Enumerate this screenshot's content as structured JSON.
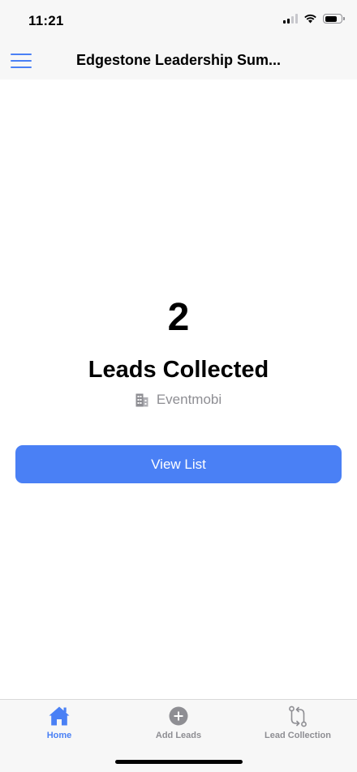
{
  "status_bar": {
    "time": "11:21"
  },
  "header": {
    "title": "Edgestone Leadership Sum...",
    "menu_icon": "hamburger-menu-icon"
  },
  "summary": {
    "lead_count": "2",
    "label": "Leads Collected",
    "organization": "Eventmobi",
    "organization_icon": "building-icon"
  },
  "actions": {
    "view_list_label": "View List"
  },
  "tab_bar": {
    "items": [
      {
        "label": "Home",
        "icon": "home-icon",
        "active": true
      },
      {
        "label": "Add Leads",
        "icon": "add-circle-icon",
        "active": false
      },
      {
        "label": "Lead Collection",
        "icon": "sync-arrows-icon",
        "active": false
      }
    ]
  },
  "colors": {
    "accent": "#4a80f5",
    "muted_text": "#8e8e93",
    "bar_background": "#f7f7f7"
  }
}
